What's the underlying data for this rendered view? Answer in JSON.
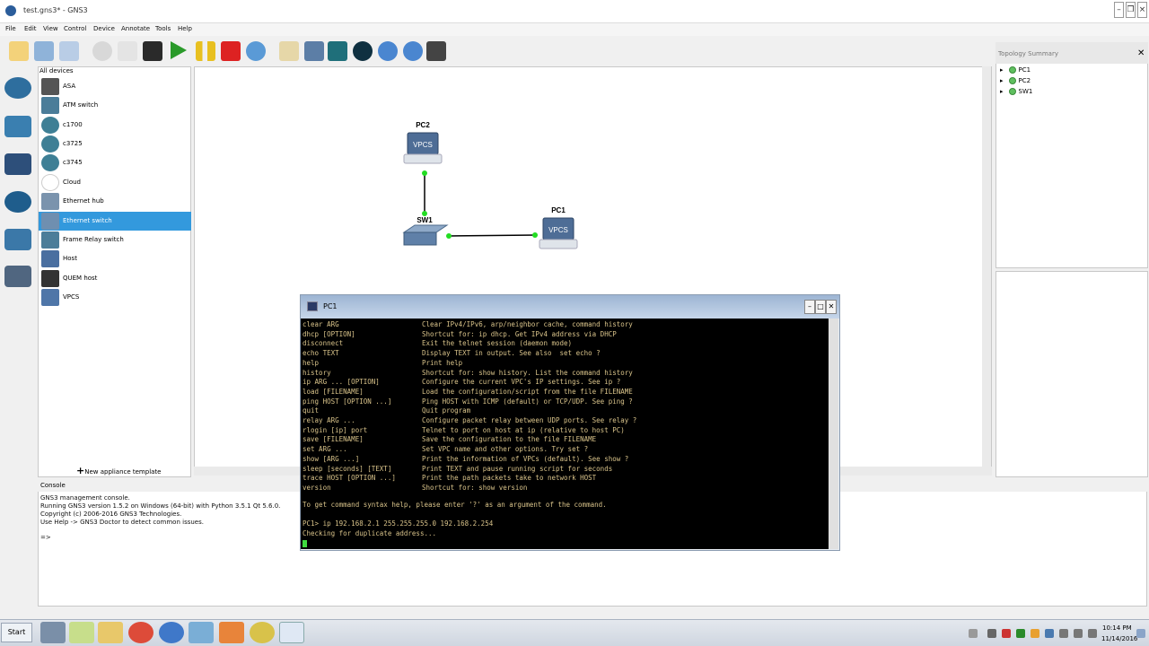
{
  "window": {
    "title": "test.gns3* - GNS3",
    "min_label": "–",
    "restore_label": "❐",
    "close_label": "×"
  },
  "menubar": {
    "items": [
      "File",
      "Edit",
      "View",
      "Control",
      "Device",
      "Annotate",
      "Tools",
      "Help"
    ]
  },
  "devices_panel": {
    "title": "All devices",
    "items": [
      {
        "label": "ASA",
        "selected": false
      },
      {
        "label": "ATM switch",
        "selected": false
      },
      {
        "label": "c1700",
        "selected": false
      },
      {
        "label": "c3725",
        "selected": false
      },
      {
        "label": "c3745",
        "selected": false
      },
      {
        "label": "Cloud",
        "selected": false
      },
      {
        "label": "Ethernet hub",
        "selected": false
      },
      {
        "label": "Ethernet switch",
        "selected": true
      },
      {
        "label": "Frame Relay switch",
        "selected": false
      },
      {
        "label": "Host",
        "selected": false
      },
      {
        "label": "QUEM host",
        "selected": false
      },
      {
        "label": "VPCS",
        "selected": false
      }
    ],
    "new_appliance": "New appliance template"
  },
  "topology": {
    "nodes": [
      {
        "label": "PC2",
        "icon_text": "VPCS"
      },
      {
        "label": "SW1"
      },
      {
        "label": "PC1",
        "icon_text": "VPCS"
      }
    ]
  },
  "topology_summary": {
    "title": "Topology Summary",
    "items": [
      "PC1",
      "PC2",
      "SW1"
    ]
  },
  "console": {
    "title": "Console",
    "lines": [
      "GNS3 management console.",
      "Running GNS3 version 1.5.2 on Windows (64-bit) with Python 3.5.1 Qt 5.6.0.",
      "Copyright (c) 2006-2016 GNS3 Technologies.",
      "Use Help -> GNS3 Doctor to detect common issues.",
      "",
      "=>"
    ]
  },
  "terminal": {
    "title": "PC1",
    "commands": [
      {
        "cmd": "clear ARG",
        "desc": "Clear IPv4/IPv6, arp/neighbor cache, command history"
      },
      {
        "cmd": "dhcp [OPTION]",
        "desc": "Shortcut for: ip dhcp. Get IPv4 address via DHCP"
      },
      {
        "cmd": "disconnect",
        "desc": "Exit the telnet session (daemon mode)"
      },
      {
        "cmd": "echo TEXT",
        "desc": "Display TEXT in output. See also  set echo ?"
      },
      {
        "cmd": "help",
        "desc": "Print help"
      },
      {
        "cmd": "history",
        "desc": "Shortcut for: show history. List the command history"
      },
      {
        "cmd": "ip ARG ... [OPTION]",
        "desc": "Configure the current VPC's IP settings. See ip ?"
      },
      {
        "cmd": "load [FILENAME]",
        "desc": "Load the configuration/script from the file FILENAME"
      },
      {
        "cmd": "ping HOST [OPTION ...]",
        "desc": "Ping HOST with ICMP (default) or TCP/UDP. See ping ?"
      },
      {
        "cmd": "quit",
        "desc": "Quit program"
      },
      {
        "cmd": "relay ARG ...",
        "desc": "Configure packet relay between UDP ports. See relay ?"
      },
      {
        "cmd": "rlogin [ip] port",
        "desc": "Telnet to port on host at ip (relative to host PC)"
      },
      {
        "cmd": "save [FILENAME]",
        "desc": "Save the configuration to the file FILENAME"
      },
      {
        "cmd": "set ARG ...",
        "desc": "Set VPC name and other options. Try set ?"
      },
      {
        "cmd": "show [ARG ...]",
        "desc": "Print the information of VPCs (default). See show ?"
      },
      {
        "cmd": "sleep [seconds] [TEXT]",
        "desc": "Print TEXT and pause running script for seconds"
      },
      {
        "cmd": "trace HOST [OPTION ...]",
        "desc": "Print the path packets take to network HOST"
      },
      {
        "cmd": "version",
        "desc": "Shortcut for: show version"
      }
    ],
    "hint": "To get command syntax help, please enter '?' as an argument of the command.",
    "prompt_line": "PC1> ip 192.168.2.1 255.255.255.0 192.168.2.254",
    "status_line": "Checking for duplicate address..."
  },
  "taskbar": {
    "start_label": "Start",
    "time": "10:14 PM",
    "date": "11/14/2016"
  },
  "colors": {
    "selection": "#3399dd",
    "terminal_text": "#d9c38a",
    "link_up": "#22dd22"
  }
}
